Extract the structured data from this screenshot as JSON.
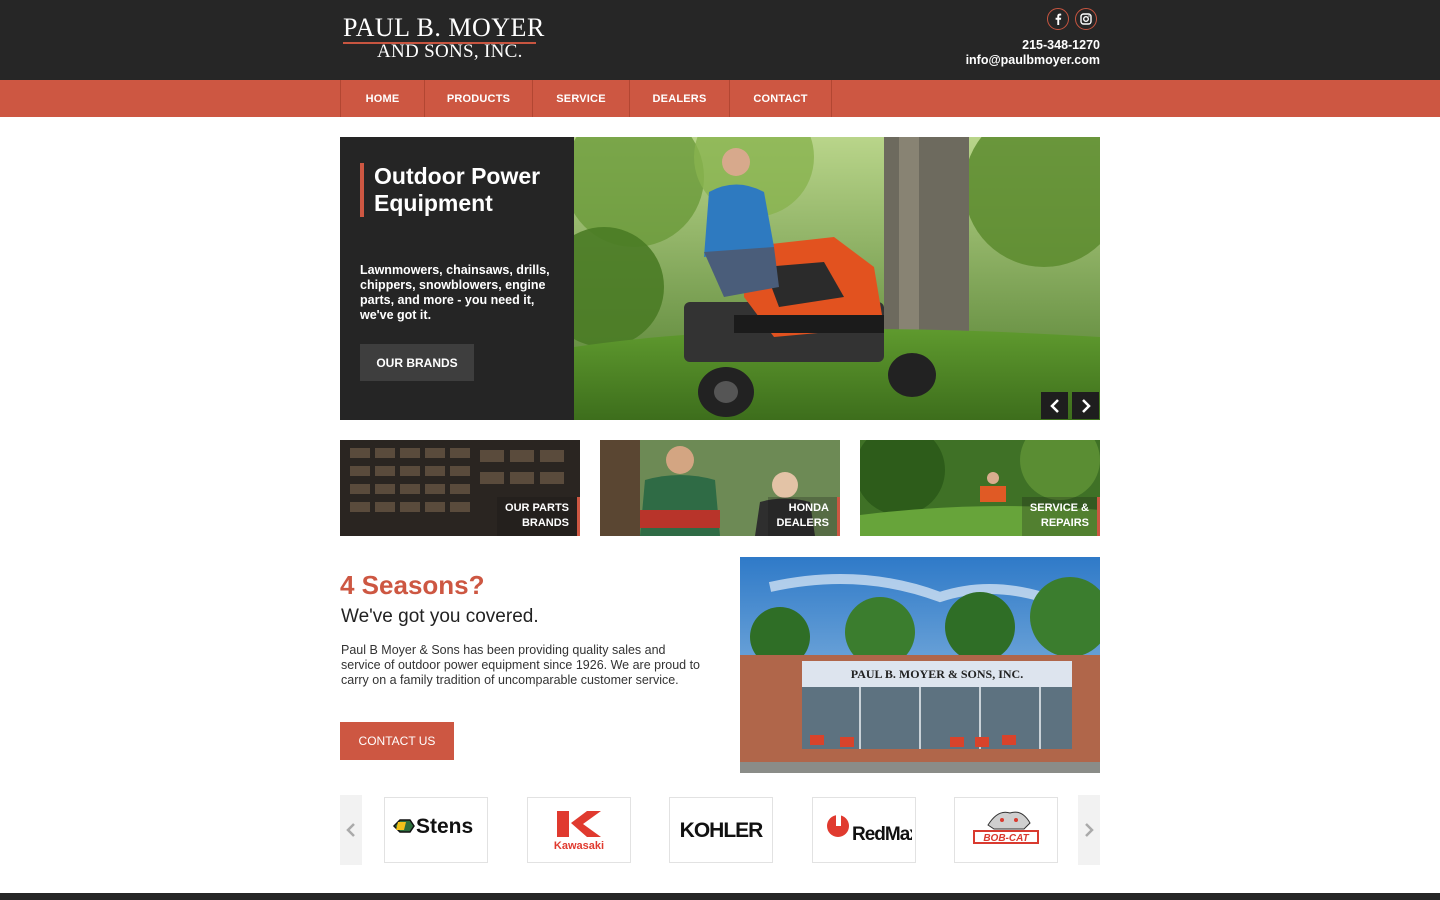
{
  "header": {
    "logo_line1": "PAUL B. MOYER",
    "logo_line2": "AND SONS, INC.",
    "phone": "215-348-1270",
    "email": "info@paulbmoyer.com",
    "social_icons": [
      "facebook-icon",
      "instagram-icon"
    ]
  },
  "nav": {
    "items": [
      "HOME",
      "PRODUCTS",
      "SERVICE",
      "DEALERS",
      "CONTACT"
    ]
  },
  "hero": {
    "title": "Outdoor Power Equipment",
    "description": "Lawnmowers, chainsaws, drills, chippers, snowblowers, engine parts, and more - you need it, we've got it.",
    "button": "OUR BRANDS"
  },
  "tiles": [
    {
      "line1": "OUR PARTS",
      "line2": "BRANDS"
    },
    {
      "line1": "HONDA",
      "line2": "DEALERS"
    },
    {
      "line1": "SERVICE &",
      "line2": "REPAIRS"
    }
  ],
  "about": {
    "title": "4 Seasons?",
    "subtitle": "We've got you covered.",
    "text": "Paul B Moyer & Sons has been providing quality sales and service of outdoor power equipment since 1926. We are proud to carry on a family tradition of uncomparable customer service.",
    "button": "CONTACT US",
    "store_sign": "PAUL B. MOYER & SONS, INC."
  },
  "brands": [
    "Stens",
    "Kawasaki",
    "KOHLER",
    "RedMax",
    "BOB-CAT"
  ],
  "colors": {
    "accent": "#cd5742",
    "dark": "#262626"
  }
}
